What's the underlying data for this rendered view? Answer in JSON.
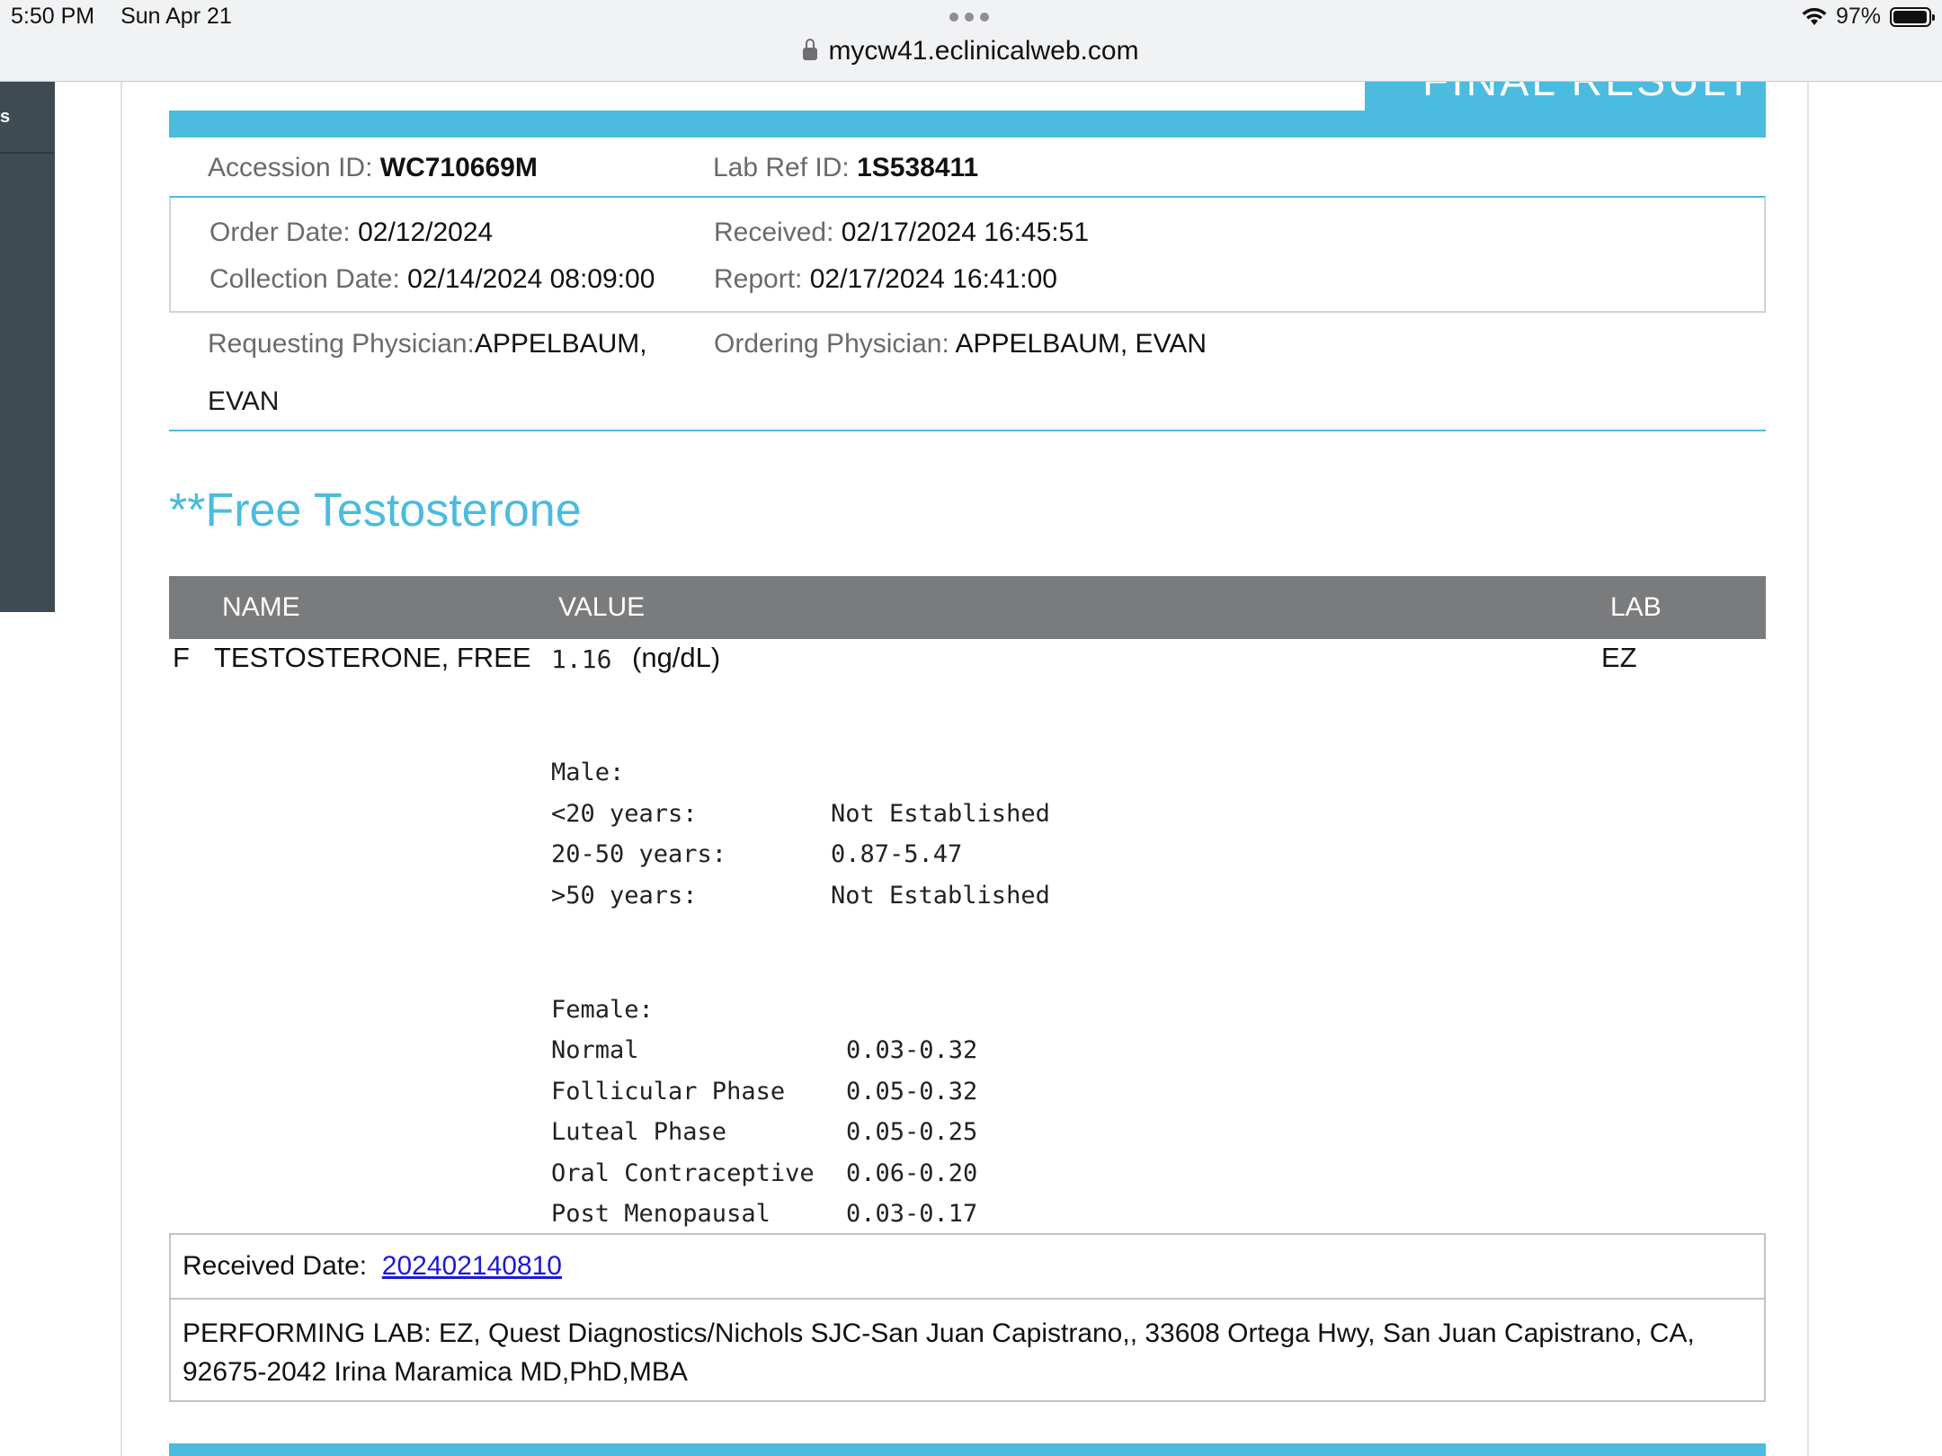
{
  "status_bar": {
    "time": "5:50 PM",
    "date": "Sun Apr 21",
    "battery": "97%",
    "url": "mycw41.eclinicalweb.com"
  },
  "sidebar": {
    "label": "s"
  },
  "header_tab": {
    "label": "FINAL RESULT"
  },
  "accession": {
    "label": "Accession ID:",
    "value": "WC710669M"
  },
  "lab_ref": {
    "label": "Lab Ref ID:",
    "value": "1S538411"
  },
  "order_date": {
    "label": "Order Date:",
    "value": "02/12/2024"
  },
  "collection_date": {
    "label": "Collection Date:",
    "value": "02/14/2024 08:09:00"
  },
  "received": {
    "label": "Received:",
    "value": "02/17/2024 16:45:51"
  },
  "report": {
    "label": "Report:",
    "value": "02/17/2024  16:41:00"
  },
  "requesting_physician": {
    "label": "Requesting Physician:",
    "value_line1": "APPELBAUM,",
    "value_line2": "EVAN"
  },
  "ordering_physician": {
    "label": "Ordering Physician:",
    "value": "APPELBAUM, EVAN"
  },
  "section_title": "**Free Testosterone",
  "table": {
    "headers": {
      "name": "NAME",
      "value": "VALUE",
      "lab": "LAB"
    },
    "row": {
      "flag": "F",
      "name": "TESTOSTERONE, FREE",
      "value": "1.16",
      "units": "(ng/dL)",
      "lab": "EZ"
    }
  },
  "reference": {
    "male_title": "Male:",
    "male": [
      {
        "label": "<20 years:",
        "range": "Not Established"
      },
      {
        "label": "20-50 years:",
        "range": "0.87-5.47"
      },
      {
        "label": ">50 years:",
        "range": "Not Established"
      }
    ],
    "female_title": "Female:",
    "female": [
      {
        "label": "Normal",
        "range": "0.03-0.32"
      },
      {
        "label": "Follicular Phase",
        "range": "0.05-0.32"
      },
      {
        "label": "Luteal Phase",
        "range": "0.05-0.25"
      },
      {
        "label": "Oral Contraceptive",
        "range": "0.06-0.20"
      },
      {
        "label": "Post Menopausal",
        "range": "0.03-0.17"
      }
    ]
  },
  "footer": {
    "received_label": "Received Date:",
    "received_link": "202402140810",
    "performing_lab": "PERFORMING LAB: EZ, Quest Diagnostics/Nichols SJC-San Juan Capistrano,, 33608 Ortega Hwy, San Juan Capistrano, CA, 92675-2042 Irina Maramica MD,PhD,MBA"
  }
}
